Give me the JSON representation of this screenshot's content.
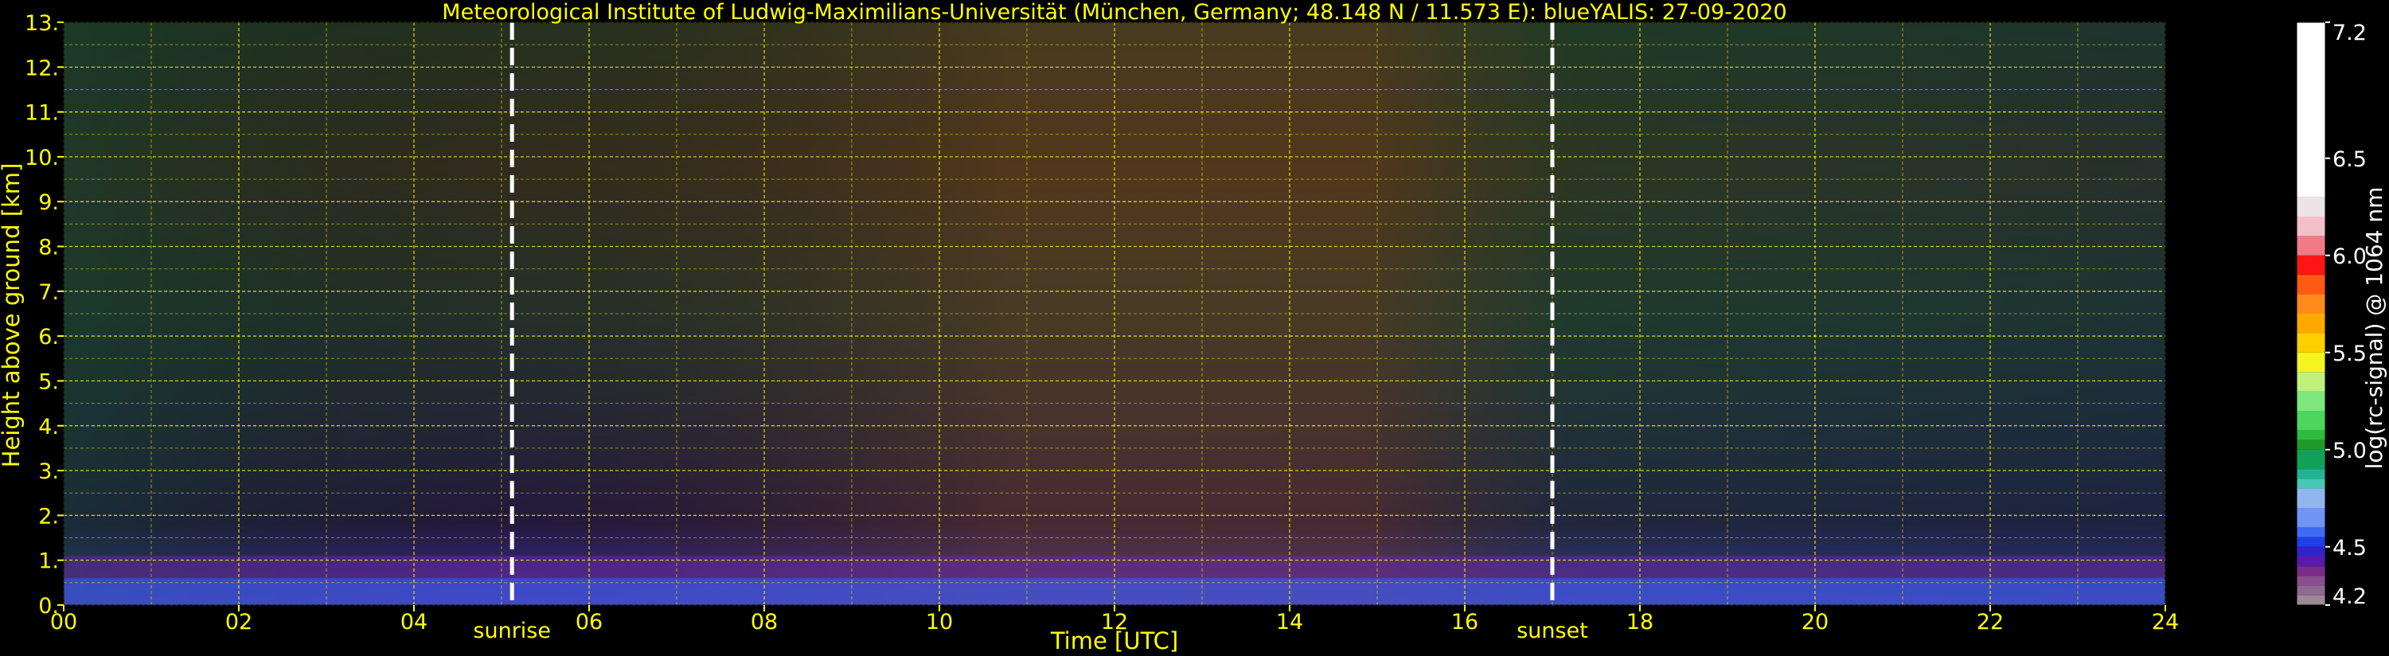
{
  "chart_data": {
    "type": "heatmap",
    "title": "Meteorological Institute of Ludwig-Maximilians-Universität (München, Germany; 48.148 N / 11.573 E):    blueYALIS: 27-09-2020",
    "xlabel": "Time [UTC]",
    "ylabel": "Height above ground [km]",
    "xlim": [
      0,
      24
    ],
    "ylim": [
      0,
      13
    ],
    "x_ticks": [
      {
        "value": 0,
        "label": "00"
      },
      {
        "value": 2,
        "label": "02"
      },
      {
        "value": 4,
        "label": "04"
      },
      {
        "value": 6,
        "label": "06"
      },
      {
        "value": 8,
        "label": "08"
      },
      {
        "value": 10,
        "label": "10"
      },
      {
        "value": 12,
        "label": "12"
      },
      {
        "value": 14,
        "label": "14"
      },
      {
        "value": 16,
        "label": "16"
      },
      {
        "value": 18,
        "label": "18"
      },
      {
        "value": 20,
        "label": "20"
      },
      {
        "value": 22,
        "label": "22"
      },
      {
        "value": 24,
        "label": "24"
      }
    ],
    "y_ticks": [
      {
        "value": 0,
        "label": "0."
      },
      {
        "value": 1,
        "label": "1."
      },
      {
        "value": 2,
        "label": "2."
      },
      {
        "value": 3,
        "label": "3."
      },
      {
        "value": 4,
        "label": "4."
      },
      {
        "value": 5,
        "label": "5."
      },
      {
        "value": 6,
        "label": "6."
      },
      {
        "value": 7,
        "label": "7."
      },
      {
        "value": 8,
        "label": "8."
      },
      {
        "value": 9,
        "label": "9."
      },
      {
        "value": 10,
        "label": "10."
      },
      {
        "value": 11,
        "label": "11."
      },
      {
        "value": 12,
        "label": "12."
      },
      {
        "value": 13,
        "label": "13."
      }
    ],
    "grid": true,
    "grid_color": "#ffff00",
    "annotations": [
      {
        "label": "sunrise",
        "x": 5.12
      },
      {
        "label": "sunset",
        "x": 17.0
      }
    ],
    "colorbar": {
      "label": "log(rc-signal) @ 1064 nm",
      "range": [
        4.2,
        7.2
      ],
      "ticks": [
        {
          "value": 4.2,
          "label": "4.2"
        },
        {
          "value": 4.5,
          "label": "4.5"
        },
        {
          "value": 5.0,
          "label": "5.0"
        },
        {
          "value": 5.5,
          "label": "5.5"
        },
        {
          "value": 6.0,
          "label": "6.0"
        },
        {
          "value": 6.5,
          "label": "6.5"
        },
        {
          "value": 7.2,
          "label": "7.2"
        }
      ],
      "bands": [
        {
          "from": 4.2,
          "to": 4.25,
          "color": "#9a8a98"
        },
        {
          "from": 4.25,
          "to": 4.3,
          "color": "#8e6a92"
        },
        {
          "from": 4.3,
          "to": 4.35,
          "color": "#8a4e8e"
        },
        {
          "from": 4.35,
          "to": 4.4,
          "color": "#7a2a88"
        },
        {
          "from": 4.4,
          "to": 4.45,
          "color": "#5a1aa8"
        },
        {
          "from": 4.45,
          "to": 4.5,
          "color": "#3322cc"
        },
        {
          "from": 4.5,
          "to": 4.55,
          "color": "#1f3fea"
        },
        {
          "from": 4.55,
          "to": 4.6,
          "color": "#3d6bf2"
        },
        {
          "from": 4.6,
          "to": 4.7,
          "color": "#6f94f3"
        },
        {
          "from": 4.7,
          "to": 4.8,
          "color": "#93b5ef"
        },
        {
          "from": 4.8,
          "to": 4.85,
          "color": "#49c7b5"
        },
        {
          "from": 4.85,
          "to": 4.9,
          "color": "#21b394"
        },
        {
          "from": 4.9,
          "to": 5.0,
          "color": "#11a05a"
        },
        {
          "from": 5.0,
          "to": 5.05,
          "color": "#1e9a2a"
        },
        {
          "from": 5.05,
          "to": 5.1,
          "color": "#2dbd3c"
        },
        {
          "from": 5.1,
          "to": 5.2,
          "color": "#4cd65e"
        },
        {
          "from": 5.2,
          "to": 5.3,
          "color": "#7fe680"
        },
        {
          "from": 5.3,
          "to": 5.4,
          "color": "#bff27a"
        },
        {
          "from": 5.4,
          "to": 5.5,
          "color": "#f4f41e"
        },
        {
          "from": 5.5,
          "to": 5.6,
          "color": "#ffd000"
        },
        {
          "from": 5.6,
          "to": 5.7,
          "color": "#ffa800"
        },
        {
          "from": 5.7,
          "to": 5.8,
          "color": "#ff8a1a"
        },
        {
          "from": 5.8,
          "to": 5.9,
          "color": "#ff5a14"
        },
        {
          "from": 5.9,
          "to": 6.0,
          "color": "#ff1414"
        },
        {
          "from": 6.0,
          "to": 6.1,
          "color": "#f07a88"
        },
        {
          "from": 6.1,
          "to": 6.2,
          "color": "#f4c0c8"
        },
        {
          "from": 6.2,
          "to": 6.3,
          "color": "#ece4e6"
        },
        {
          "from": 6.3,
          "to": 7.2,
          "color": "#ffffff"
        }
      ]
    }
  }
}
